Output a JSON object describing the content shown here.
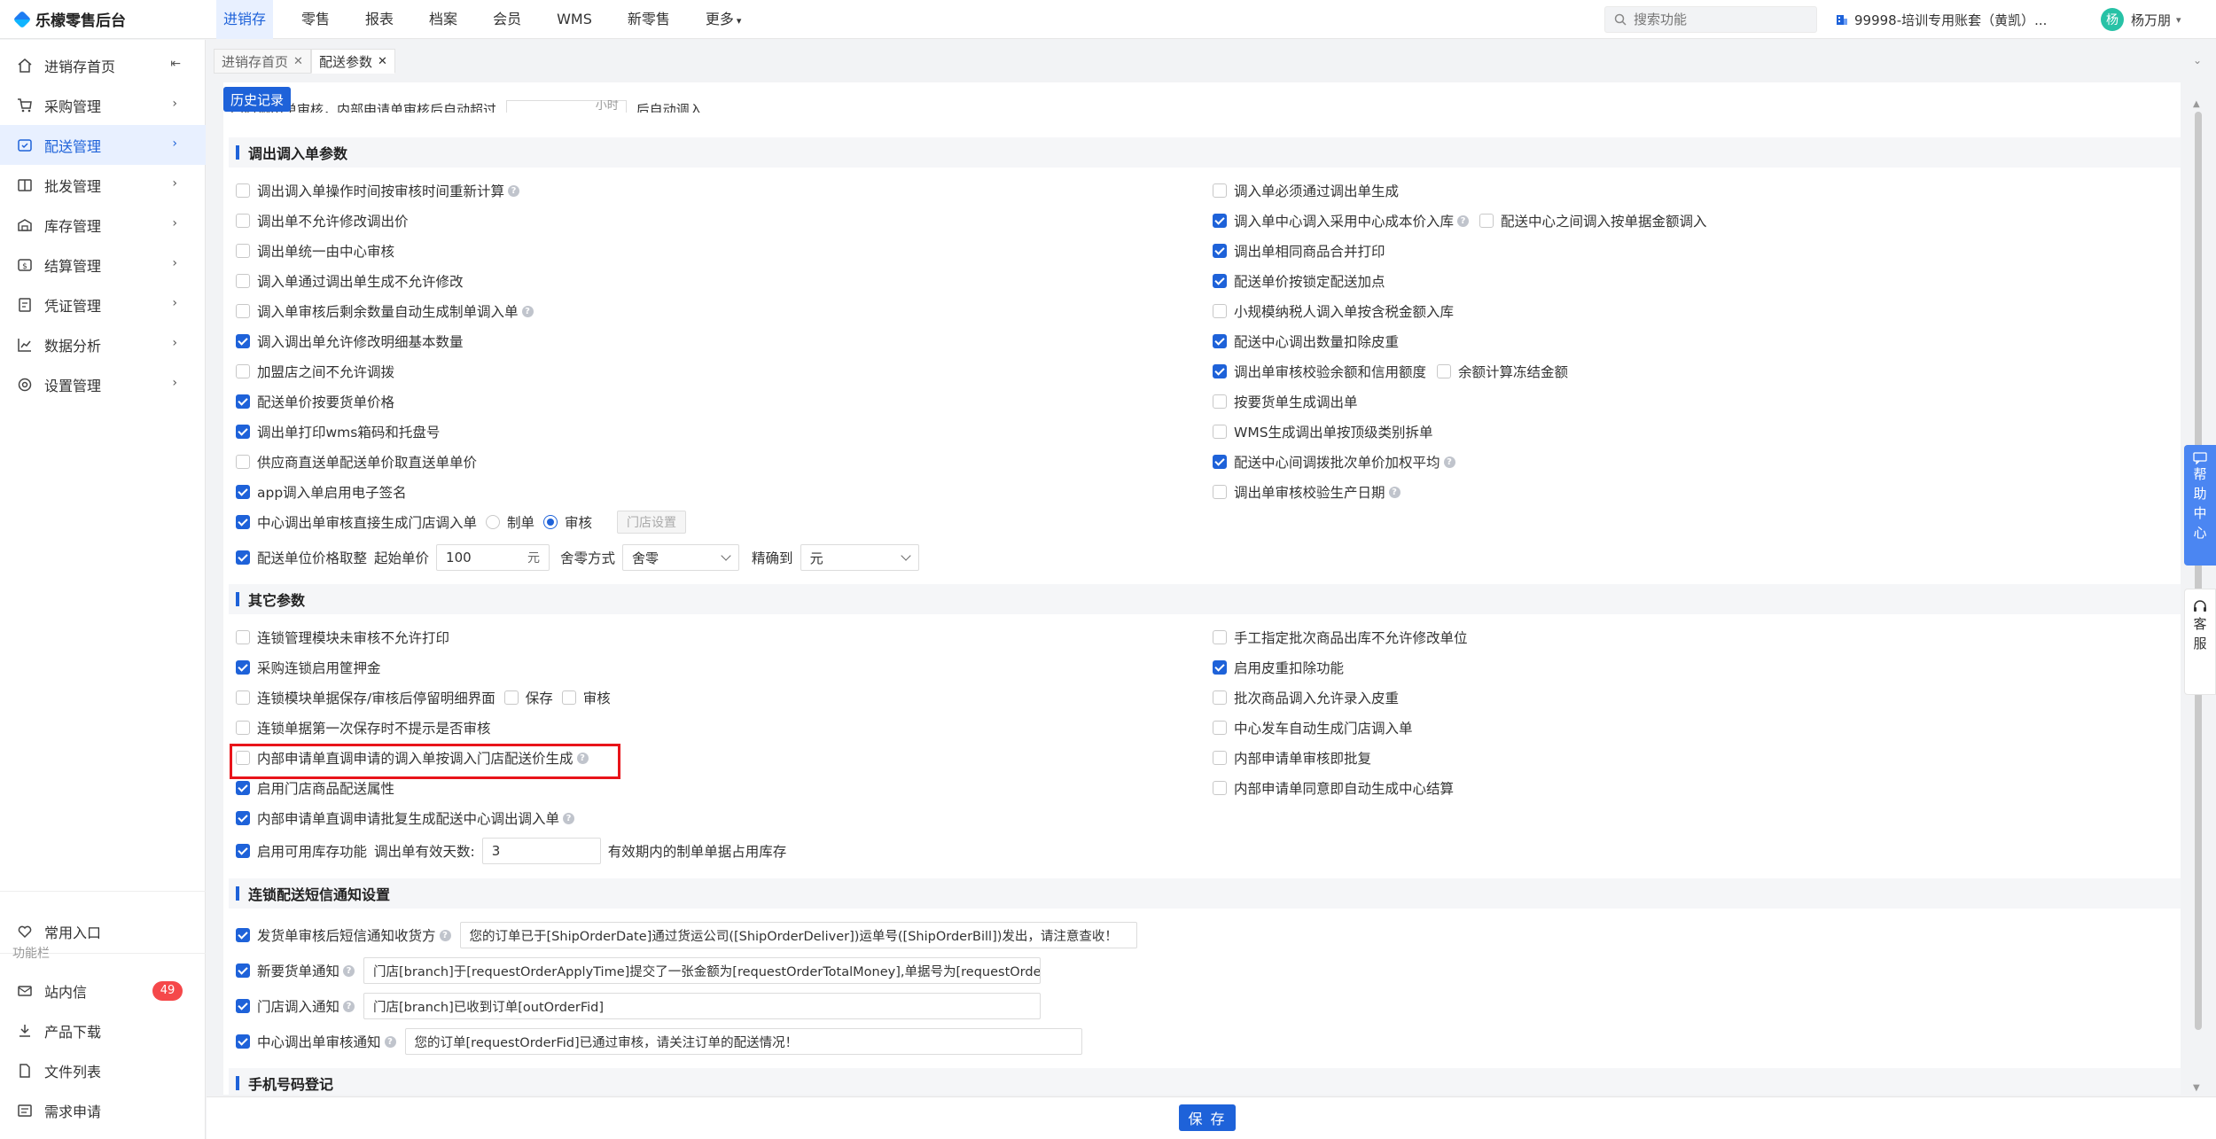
{
  "app": {
    "title": "乐檬零售后台"
  },
  "topnav": [
    "进销存",
    "零售",
    "报表",
    "档案",
    "会员",
    "WMS",
    "新零售",
    "更多"
  ],
  "search": {
    "placeholder": "搜索功能"
  },
  "account": "99998-培训专用账套（黄凯）...",
  "user": {
    "name": "杨万朋",
    "avatar": "杨"
  },
  "sidebar": {
    "items": [
      "进销存首页",
      "采购管理",
      "配送管理",
      "批发管理",
      "库存管理",
      "结算管理",
      "凭证管理",
      "数据分析",
      "设置管理"
    ],
    "common": "常用入口",
    "func_label": "功能栏",
    "func_items": [
      "站内信",
      "产品下载",
      "文件列表",
      "需求申请"
    ],
    "badge": "49"
  },
  "tabs": [
    "进销存首页",
    "配送参数"
  ],
  "history_button": "历史记录",
  "top_clip": {
    "left": "门店调出单审核，内部申请单审核后自动超过",
    "unit": "小时",
    "right": "后自动调入"
  },
  "sections": {
    "transfer": "调出调入单参数",
    "other": "其它参数",
    "sms": "连锁配送短信通知设置",
    "phone": "手机号码登记"
  },
  "transfer_left": [
    {
      "label": "调出调入单操作时间按审核时间重新计算",
      "checked": false,
      "help": true
    },
    {
      "label": "调出单不允许修改调出价",
      "checked": false
    },
    {
      "label": "调出单统一由中心审核",
      "checked": false
    },
    {
      "label": "调入单通过调出单生成不允许修改",
      "checked": false
    },
    {
      "label": "调入单审核后剩余数量自动生成制单调入单",
      "checked": false,
      "help": true
    },
    {
      "label": "调入调出单允许修改明细基本数量",
      "checked": true
    },
    {
      "label": "加盟店之间不允许调拨",
      "checked": false
    },
    {
      "label": "配送单价按要货单价格",
      "checked": true
    },
    {
      "label": "调出单打印wms箱码和托盘号",
      "checked": true
    },
    {
      "label": "供应商直送单配送单价取直送单单价",
      "checked": false
    },
    {
      "label": "app调入单启用电子签名",
      "checked": true
    }
  ],
  "transfer_right": [
    {
      "label": "调入单必须通过调出单生成",
      "checked": false
    },
    {
      "label": "调入单中心调入采用中心成本价入库",
      "checked": true,
      "help": true,
      "extra": {
        "label": "配送中心之间调入按单据金额调入",
        "checked": false
      }
    },
    {
      "label": "调出单相同商品合并打印",
      "checked": true
    },
    {
      "label": "配送单价按锁定配送加点",
      "checked": true
    },
    {
      "label": "小规模纳税人调入单按含税金额入库",
      "checked": false
    },
    {
      "label": "配送中心调出数量扣除皮重",
      "checked": true
    },
    {
      "label": "调出单审核校验余额和信用额度",
      "checked": true,
      "extra": {
        "label": "余额计算冻结金额",
        "checked": false
      }
    },
    {
      "label": "按要货单生成调出单",
      "checked": false
    },
    {
      "label": "WMS生成调出单按顶级类别拆单",
      "checked": false
    },
    {
      "label": "配送中心间调拨批次单价加权平均",
      "checked": true,
      "help": true
    },
    {
      "label": "调出单审核校验生产日期",
      "checked": false,
      "help": true
    }
  ],
  "center_row": {
    "label": "中心调出单审核直接生成门店调入单",
    "checked": true,
    "opt1": "制单",
    "opt2": "审核",
    "button": "门店设置"
  },
  "price_row": {
    "label": "配送单位价格取整",
    "start_label": "起始单价",
    "start_value": "100",
    "unit": "元",
    "round_label": "舍零方式",
    "round_value": "舍零",
    "precision_label": "精确到",
    "precision_value": "元"
  },
  "other_left": [
    {
      "label": "连锁管理模块未审核不允许打印",
      "checked": false
    },
    {
      "label": "采购连锁启用筐押金",
      "checked": true
    },
    {
      "label": "连锁模块单据保存/审核后停留明细界面",
      "checked": false,
      "opts": [
        "保存",
        "审核"
      ]
    },
    {
      "label": "连锁单据第一次保存时不提示是否审核",
      "checked": false
    },
    {
      "label": "内部申请单直调申请的调入单按调入门店配送价生成",
      "checked": false,
      "help": true
    },
    {
      "label": "启用门店商品配送属性",
      "checked": true
    },
    {
      "label": "内部申请单直调申请批复生成配送中心调出调入单",
      "checked": true,
      "help": true
    }
  ],
  "other_right": [
    {
      "label": "手工指定批次商品出库不允许修改单位",
      "checked": false
    },
    {
      "label": "启用皮重扣除功能",
      "checked": true
    },
    {
      "label": "批次商品调入允许录入皮重",
      "checked": false
    },
    {
      "label": "中心发车自动生成门店调入单",
      "checked": false
    },
    {
      "label": "内部申请单审核即批复",
      "checked": false
    },
    {
      "label": "内部申请单同意即自动生成中心结算",
      "checked": false
    }
  ],
  "stock_row": {
    "label": "启用可用库存功能",
    "days_label": "调出单有效天数:",
    "days_value": "3",
    "suffix": "有效期内的制单单据占用库存",
    "checked": true
  },
  "sms": [
    {
      "label": "发货单审核后短信通知收货方",
      "checked": true,
      "text": "您的订单已于[ShipOrderDate]通过货运公司([ShipOrderDeliver])运单号([ShipOrderBill])发出，请注意查收！"
    },
    {
      "label": "新要货单通知",
      "checked": true,
      "text": "门店[branch]于[requestOrderApplyTime]提交了一张金额为[requestOrderTotalMoney],单据号为[requestOrde"
    },
    {
      "label": "门店调入通知",
      "checked": true,
      "text": "门店[branch]已收到订单[outOrderFid]"
    },
    {
      "label": "中心调出单审核通知",
      "checked": true,
      "text": "您的订单[requestOrderFid]已通过审核，请关注订单的配送情况！"
    }
  ],
  "save_button": "保 存",
  "help_center": [
    "帮",
    "助",
    "中",
    "心"
  ],
  "service": [
    "客",
    "服"
  ],
  "colors": {
    "primary": "#1e62d9",
    "highlight": "#e8141a",
    "badge": "#f5484a"
  }
}
